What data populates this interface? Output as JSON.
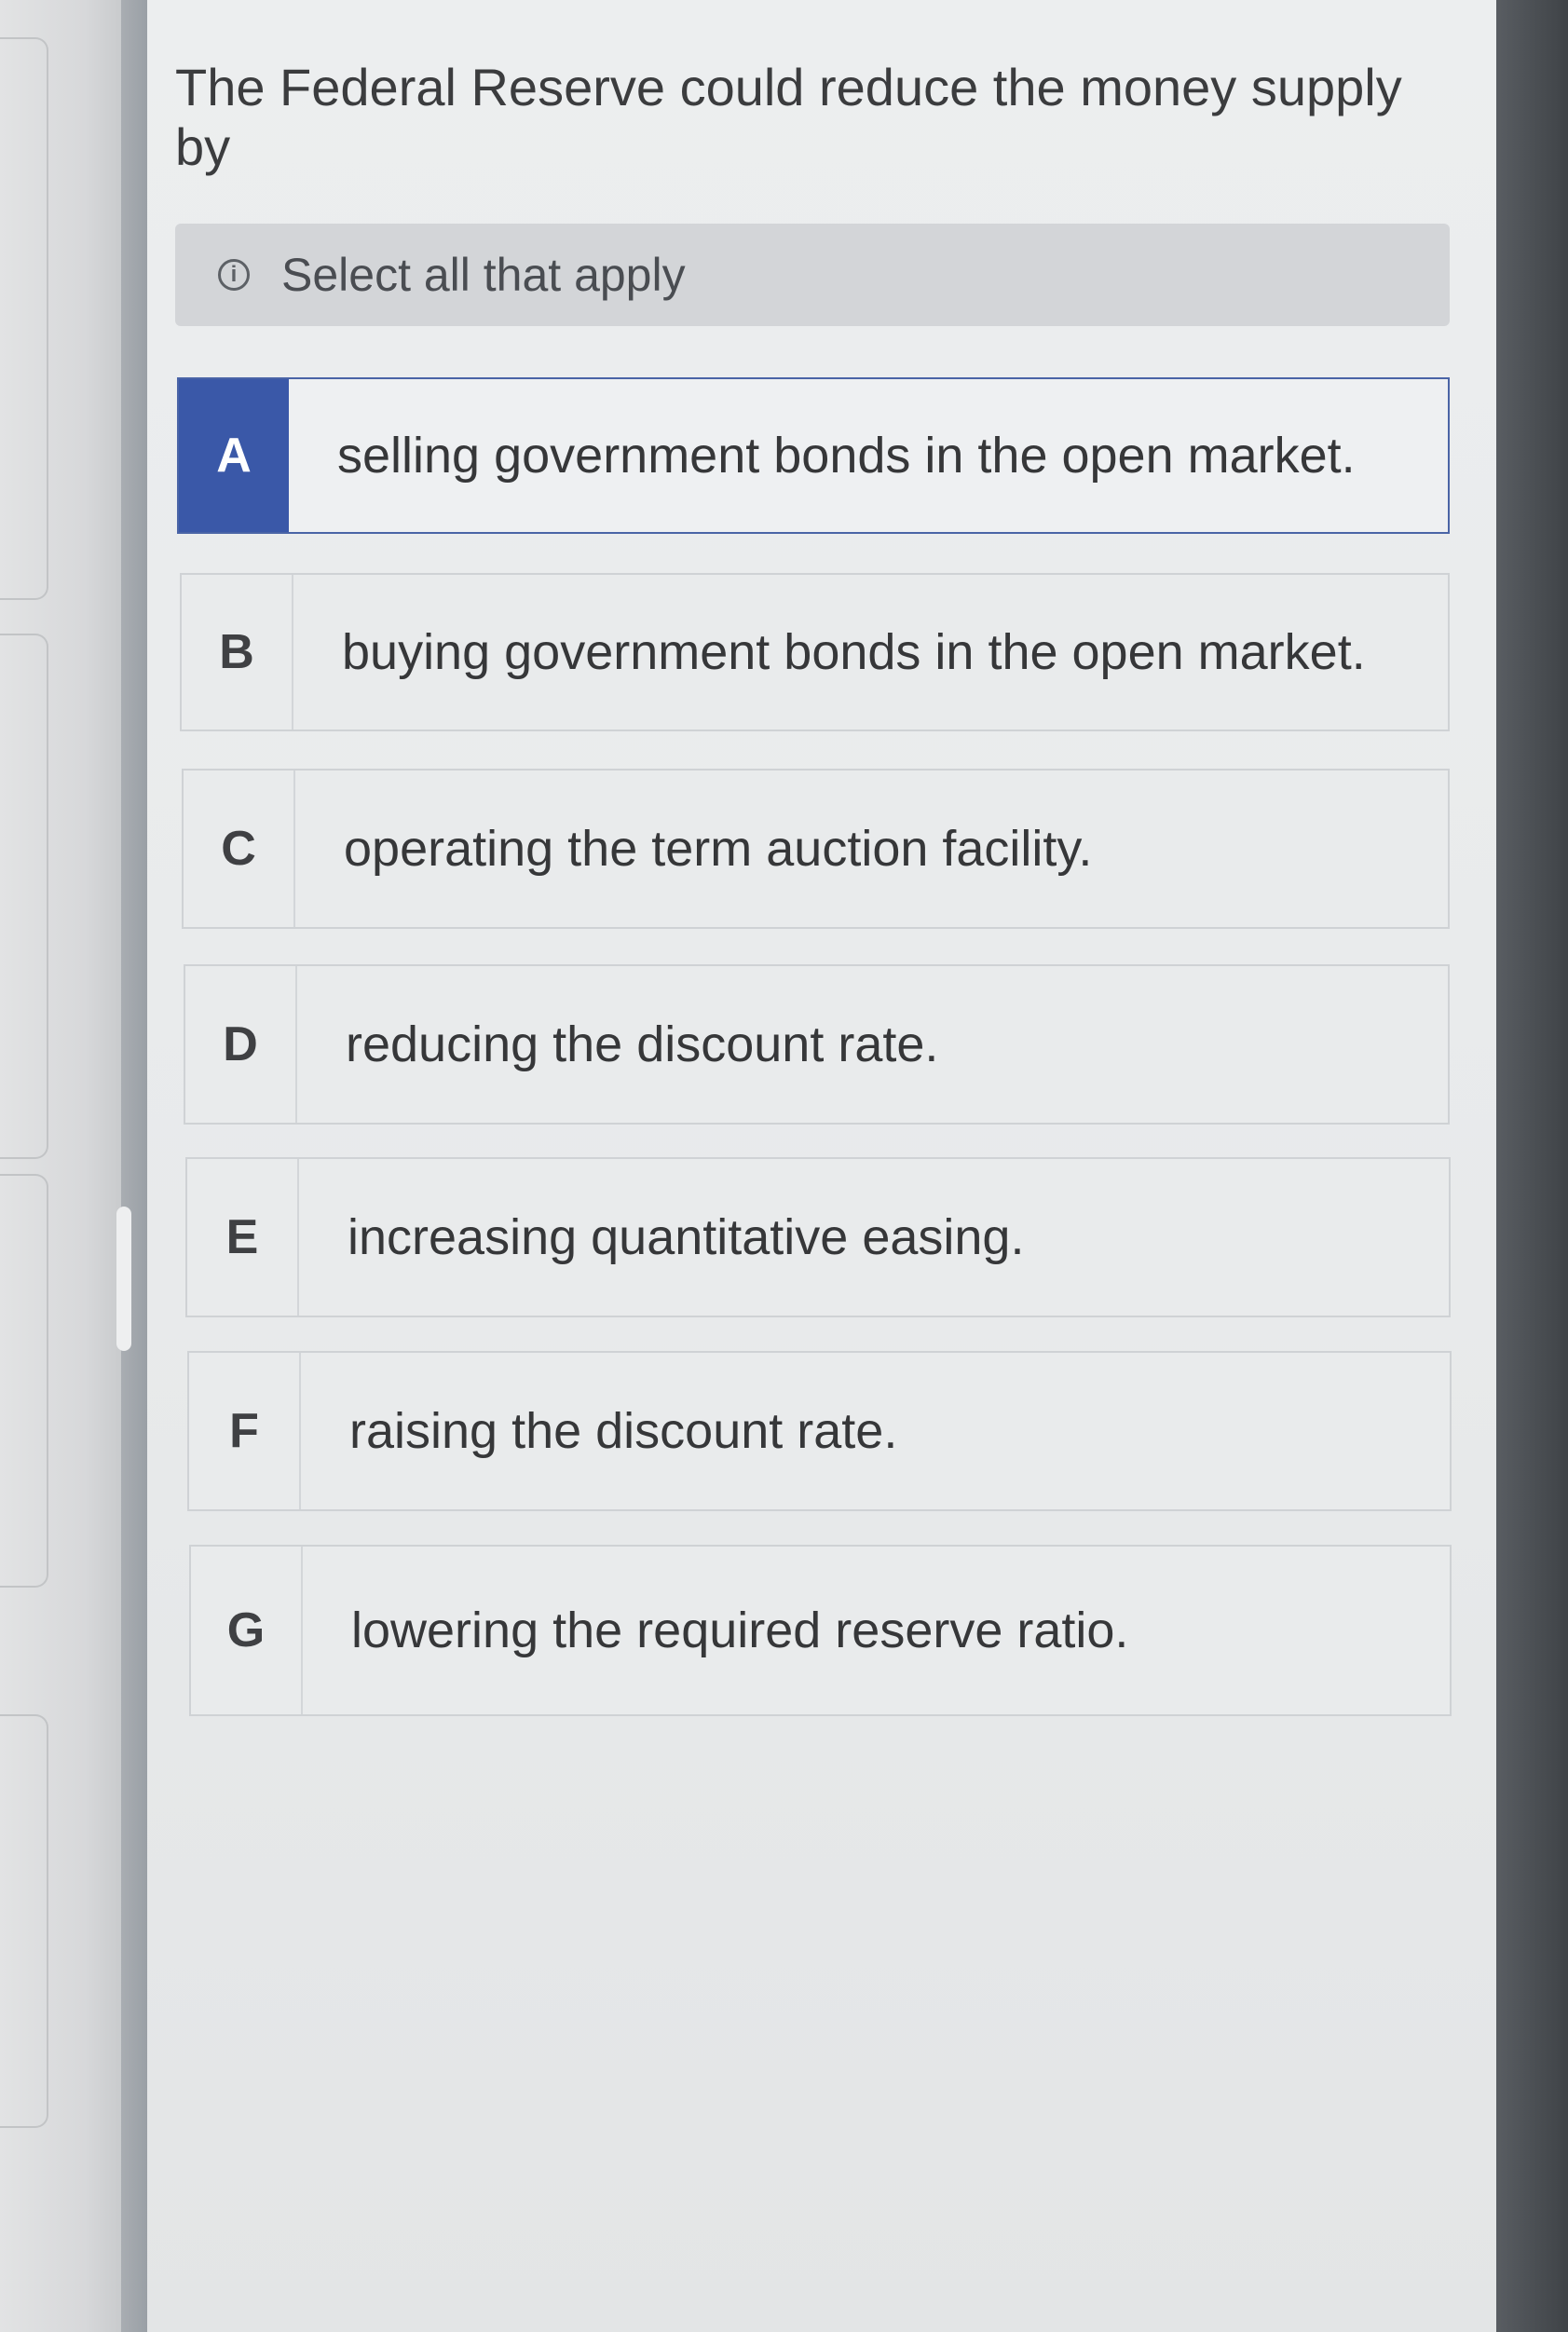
{
  "question": {
    "text": "The Federal Reserve could reduce the money supply by"
  },
  "hint": {
    "icon": "info-icon",
    "icon_glyph": "i",
    "text": "Select all that apply"
  },
  "options": [
    {
      "letter": "A",
      "text": "selling government bonds in the open market.",
      "selected": true
    },
    {
      "letter": "B",
      "text": "buying government bonds in the open market.",
      "selected": false
    },
    {
      "letter": "C",
      "text": "operating the term auction facility.",
      "selected": false
    },
    {
      "letter": "D",
      "text": "reducing the discount rate.",
      "selected": false
    },
    {
      "letter": "E",
      "text": "increasing quantitative easing.",
      "selected": false
    },
    {
      "letter": "F",
      "text": "raising the discount rate.",
      "selected": false
    },
    {
      "letter": "G",
      "text": "lowering the required reserve ratio.",
      "selected": false
    }
  ],
  "colors": {
    "selected_accent": "#3a58a8",
    "hint_background": "#d3d5d8",
    "panel_background": "#eceeef"
  }
}
